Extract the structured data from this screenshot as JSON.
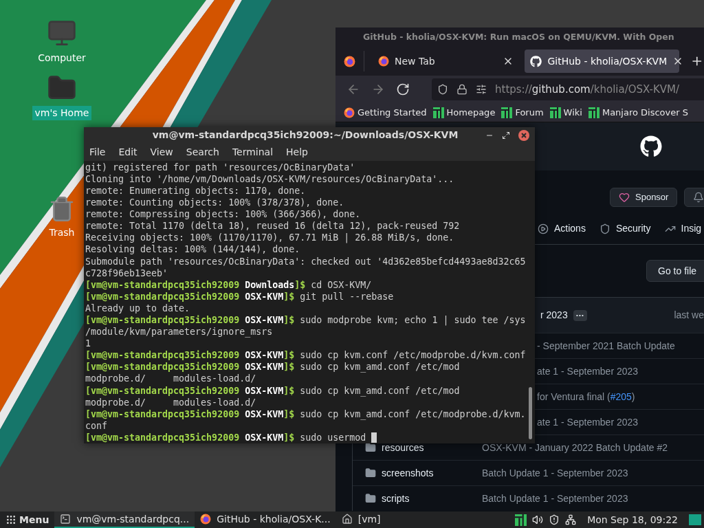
{
  "desktop_icons": [
    {
      "label": "Computer",
      "kind": "computer",
      "selected": false
    },
    {
      "label": "vm's Home",
      "kind": "home",
      "selected": true
    },
    {
      "label": "Trash",
      "kind": "trash",
      "selected": false
    }
  ],
  "browser": {
    "title": "GitHub - kholia/OSX-KVM: Run macOS on QEMU/KVM. With Open",
    "tabs": [
      {
        "label": "New Tab",
        "kind": "firefox",
        "selected": false
      },
      {
        "label": "GitHub - kholia/OSX-KVM",
        "kind": "github",
        "selected": true
      }
    ],
    "url": {
      "scheme": "https://",
      "host": "github.com",
      "path": "/kholia/OSX-KVM/"
    },
    "bookmarks": [
      {
        "label": "Getting Started",
        "kind": "firefox"
      },
      {
        "label": "Homepage",
        "kind": "manjaro"
      },
      {
        "label": "Forum",
        "kind": "manjaro"
      },
      {
        "label": "Wiki",
        "kind": "manjaro"
      },
      {
        "label": "Manjaro Discover S",
        "kind": "manjaro"
      }
    ],
    "page": {
      "sponsor": "Sponsor",
      "nav": [
        {
          "label": "Actions",
          "kind": "actions"
        },
        {
          "label": "Security",
          "kind": "security"
        },
        {
          "label": "Insig",
          "kind": "insights"
        }
      ],
      "go_to_file": "Go to file",
      "commit_header": {
        "message": "r 2023",
        "more": "···",
        "time": "last we"
      },
      "files": [
        {
          "kind": "partial",
          "message": "- September 2021 Batch Update"
        },
        {
          "kind": "partial",
          "message": "ate 1 - September 2023"
        },
        {
          "kind": "partial",
          "message": "for Ventura final (",
          "link": "#205",
          "after": ")"
        },
        {
          "kind": "partial",
          "message": "ate 1 - September 2023"
        },
        {
          "kind": "folder",
          "name": "resources",
          "message": "OSX-KVM - January 2022 Batch Update #2"
        },
        {
          "kind": "folder",
          "name": "screenshots",
          "message": "Batch Update 1 - September 2023"
        },
        {
          "kind": "folder",
          "name": "scripts",
          "message": "Batch Update 1 - September 2023"
        }
      ]
    }
  },
  "terminal": {
    "title": "vm@vm-standardpcq35ich92009:~/Downloads/OSX-KVM",
    "menu": [
      "File",
      "Edit",
      "View",
      "Search",
      "Terminal",
      "Help"
    ],
    "cursor": true,
    "lines": [
      {
        "kind": "output",
        "text": "git) registered for path 'resources/OcBinaryData'"
      },
      {
        "kind": "output",
        "text": "Cloning into '/home/vm/Downloads/OSX-KVM/resources/OcBinaryData'..."
      },
      {
        "kind": "output",
        "text": "remote: Enumerating objects: 1170, done."
      },
      {
        "kind": "output",
        "text": "remote: Counting objects: 100% (378/378), done."
      },
      {
        "kind": "output",
        "text": "remote: Compressing objects: 100% (366/366), done."
      },
      {
        "kind": "output",
        "text": "remote: Total 1170 (delta 18), reused 16 (delta 12), pack-reused 792"
      },
      {
        "kind": "output",
        "text": "Receiving objects: 100% (1170/1170), 67.71 MiB | 26.88 MiB/s, done."
      },
      {
        "kind": "output",
        "text": "Resolving deltas: 100% (144/144), done."
      },
      {
        "kind": "output",
        "text": "Submodule path 'resources/OcBinaryData': checked out '4d362e85befcd4493ae8d32c65"
      },
      {
        "kind": "output",
        "text": "c728f96eb13eeb'"
      },
      {
        "kind": "prompt",
        "user": "[vm@vm-standardpcq35ich92009",
        "dir": "Downloads",
        "end": "]$",
        "command": "cd OSX-KVM/"
      },
      {
        "kind": "prompt",
        "user": "[vm@vm-standardpcq35ich92009",
        "dir": "OSX-KVM",
        "end": "]$",
        "command": "git pull --rebase"
      },
      {
        "kind": "output",
        "text": "Already up to date."
      },
      {
        "kind": "prompt",
        "user": "[vm@vm-standardpcq35ich92009",
        "dir": "OSX-KVM",
        "end": "]$",
        "command": "sudo modprobe kvm; echo 1 | sudo tee /sys"
      },
      {
        "kind": "output",
        "text": "/module/kvm/parameters/ignore_msrs"
      },
      {
        "kind": "output",
        "text": "1"
      },
      {
        "kind": "prompt",
        "user": "[vm@vm-standardpcq35ich92009",
        "dir": "OSX-KVM",
        "end": "]$",
        "command": "sudo cp kvm.conf /etc/modprobe.d/kvm.conf"
      },
      {
        "kind": "prompt",
        "user": "[vm@vm-standardpcq35ich92009",
        "dir": "OSX-KVM",
        "end": "]$",
        "command": "sudo cp kvm_amd.conf /etc/mod"
      },
      {
        "kind": "output",
        "text": "modprobe.d/     modules-load.d/"
      },
      {
        "kind": "prompt",
        "user": "[vm@vm-standardpcq35ich92009",
        "dir": "OSX-KVM",
        "end": "]$",
        "command": "sudo cp kvm_amd.conf /etc/mod"
      },
      {
        "kind": "output",
        "text": "modprobe.d/     modules-load.d/"
      },
      {
        "kind": "prompt",
        "user": "[vm@vm-standardpcq35ich92009",
        "dir": "OSX-KVM",
        "end": "]$",
        "command": "sudo cp kvm_amd.conf /etc/modprobe.d/kvm."
      },
      {
        "kind": "output",
        "text": "conf"
      },
      {
        "kind": "prompt",
        "user": "[vm@vm-standardpcq35ich92009",
        "dir": "OSX-KVM",
        "end": "]$",
        "command": "sudo usermod "
      }
    ]
  },
  "taskbar": {
    "menu": "Menu",
    "windows": [
      {
        "label": "vm@vm-standardpcq...",
        "kind": "terminal",
        "selected": true
      },
      {
        "label": "GitHub - kholia/OSX-K...",
        "kind": "firefox",
        "selected": false
      },
      {
        "label": "[vm]",
        "kind": "home",
        "selected": false
      }
    ],
    "clock": "Mon Sep 18, 09:22"
  }
}
